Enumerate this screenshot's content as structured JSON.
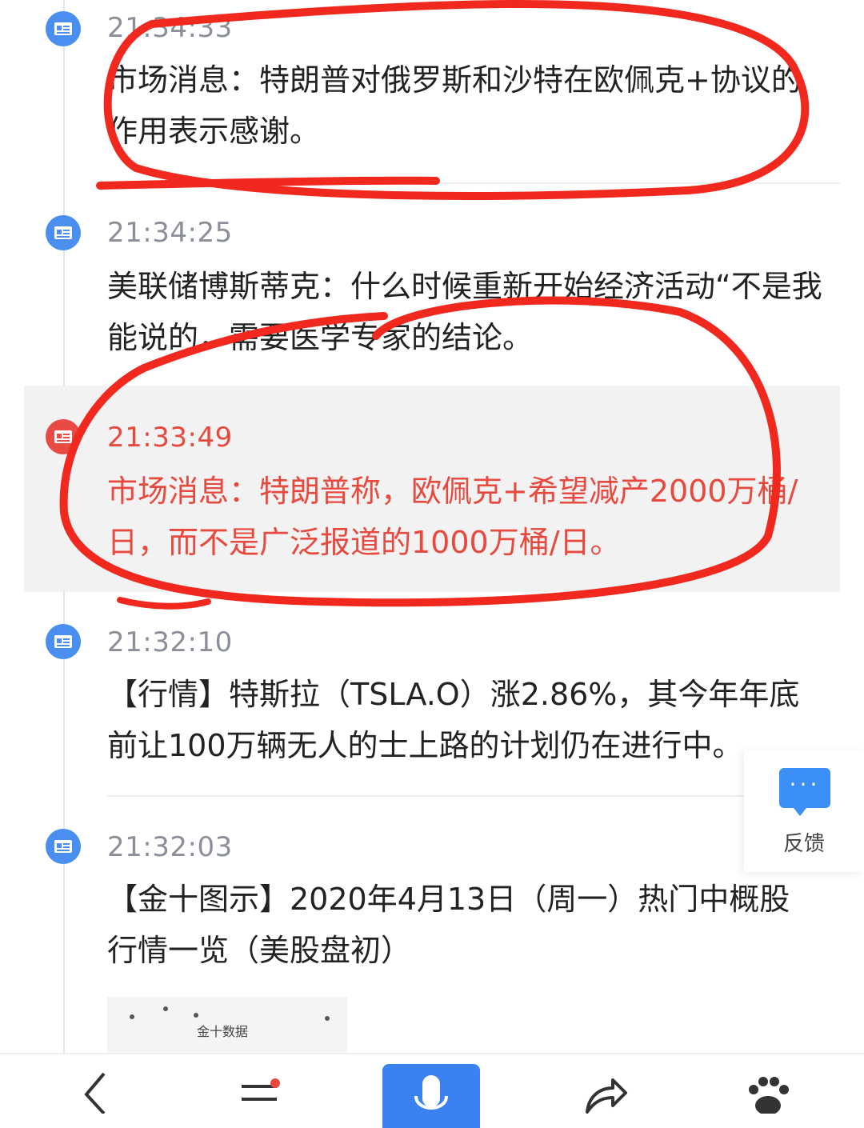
{
  "news": [
    {
      "time": "21:34:33",
      "text": "市场消息：特朗普对俄罗斯和沙特在欧佩克+协议的作用表示感谢。",
      "highlighted": false
    },
    {
      "time": "21:34:25",
      "text": "美联储博斯蒂克：什么时候重新开始经济活动“不是我能说的，需要医学专家的结论。",
      "highlighted": false
    },
    {
      "time": "21:33:49",
      "text": "市场消息：特朗普称，欧佩克+希望减产2000万桶/日，而不是广泛报道的1000万桶/日。",
      "highlighted": true
    },
    {
      "time": "21:32:10",
      "text": "【行情】特斯拉（TSLA.O）涨2.86%，其今年年底前让100万辆无人的士上路的计划仍在进行中。",
      "highlighted": false
    },
    {
      "time": "21:32:03",
      "text": "【金十图示】2020年4月13日（周一）热门中概股行情一览（美股盘初）",
      "highlighted": false
    }
  ],
  "thumbnail": {
    "label": "金十数据"
  },
  "feedback": {
    "dots": "···",
    "label": "反馈"
  },
  "colors": {
    "accent": "#3b82f0",
    "highlight_text": "#e8493e",
    "annotation": "#f0281e"
  },
  "bottom_bar": {
    "icons": [
      "back-icon",
      "menu-icon",
      "mic-icon",
      "share-icon",
      "paw-icon"
    ]
  }
}
